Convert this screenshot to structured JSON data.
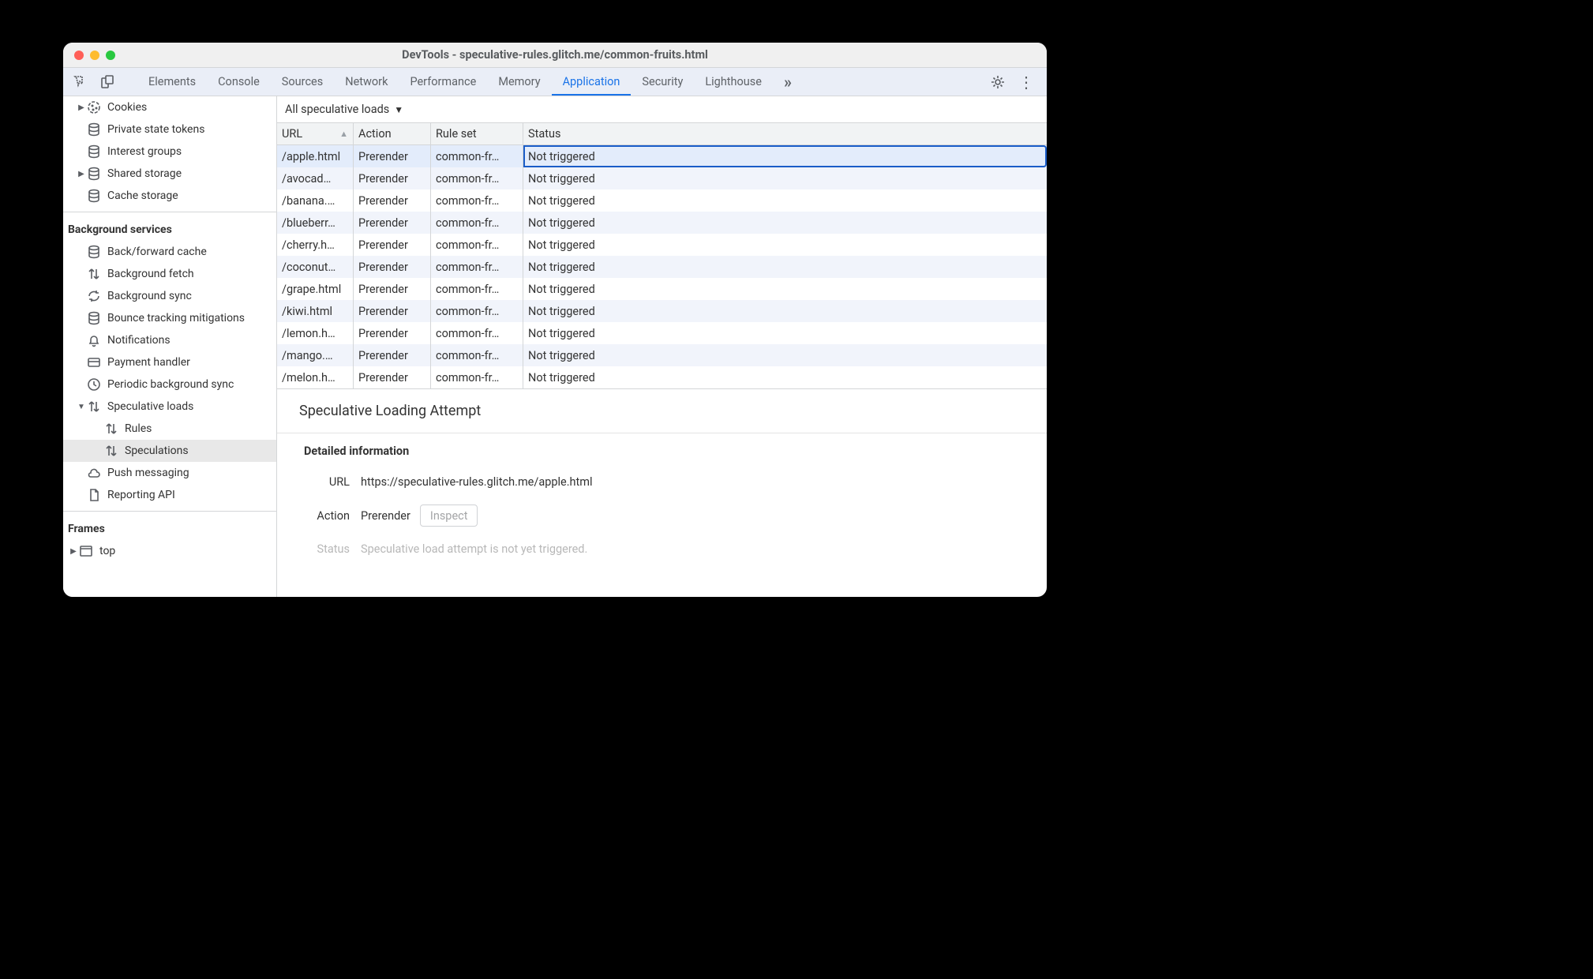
{
  "window_title": "DevTools - speculative-rules.glitch.me/common-fruits.html",
  "tabs": {
    "elements": "Elements",
    "console": "Console",
    "sources": "Sources",
    "network": "Network",
    "performance": "Performance",
    "memory": "Memory",
    "application": "Application",
    "security": "Security",
    "lighthouse": "Lighthouse"
  },
  "sidebar": {
    "storage_items": [
      {
        "label": "Cookies",
        "icon": "cookie",
        "arrow": "right"
      },
      {
        "label": "Private state tokens",
        "icon": "db",
        "arrow": ""
      },
      {
        "label": "Interest groups",
        "icon": "db",
        "arrow": ""
      },
      {
        "label": "Shared storage",
        "icon": "db",
        "arrow": "right"
      },
      {
        "label": "Cache storage",
        "icon": "db",
        "arrow": ""
      }
    ],
    "bg_header": "Background services",
    "bg_items": [
      {
        "label": "Back/forward cache",
        "icon": "db",
        "arrow": ""
      },
      {
        "label": "Background fetch",
        "icon": "updown",
        "arrow": ""
      },
      {
        "label": "Background sync",
        "icon": "sync",
        "arrow": ""
      },
      {
        "label": "Bounce tracking mitigations",
        "icon": "db",
        "arrow": ""
      },
      {
        "label": "Notifications",
        "icon": "bell",
        "arrow": ""
      },
      {
        "label": "Payment handler",
        "icon": "card",
        "arrow": ""
      },
      {
        "label": "Periodic background sync",
        "icon": "clock",
        "arrow": ""
      },
      {
        "label": "Speculative loads",
        "icon": "updown",
        "arrow": "down",
        "children": [
          {
            "label": "Rules",
            "icon": "updown"
          },
          {
            "label": "Speculations",
            "icon": "updown",
            "selected": true
          }
        ]
      },
      {
        "label": "Push messaging",
        "icon": "cloud",
        "arrow": ""
      },
      {
        "label": "Reporting API",
        "icon": "page",
        "arrow": ""
      }
    ],
    "frames_header": "Frames",
    "frames_item": {
      "label": "top",
      "icon": "frame",
      "arrow": "right"
    }
  },
  "filter_label": "All speculative loads",
  "table": {
    "headers": {
      "url": "URL",
      "action": "Action",
      "ruleset": "Rule set",
      "status": "Status"
    },
    "rows": [
      {
        "url": "/apple.html",
        "action": "Prerender",
        "ruleset": "common-fr…",
        "status": "Not triggered",
        "sel": true
      },
      {
        "url": "/avocad…",
        "action": "Prerender",
        "ruleset": "common-fr…",
        "status": "Not triggered"
      },
      {
        "url": "/banana.…",
        "action": "Prerender",
        "ruleset": "common-fr…",
        "status": "Not triggered"
      },
      {
        "url": "/blueberr…",
        "action": "Prerender",
        "ruleset": "common-fr…",
        "status": "Not triggered"
      },
      {
        "url": "/cherry.h…",
        "action": "Prerender",
        "ruleset": "common-fr…",
        "status": "Not triggered"
      },
      {
        "url": "/coconut…",
        "action": "Prerender",
        "ruleset": "common-fr…",
        "status": "Not triggered"
      },
      {
        "url": "/grape.html",
        "action": "Prerender",
        "ruleset": "common-fr…",
        "status": "Not triggered"
      },
      {
        "url": "/kiwi.html",
        "action": "Prerender",
        "ruleset": "common-fr…",
        "status": "Not triggered"
      },
      {
        "url": "/lemon.h…",
        "action": "Prerender",
        "ruleset": "common-fr…",
        "status": "Not triggered"
      },
      {
        "url": "/mango.…",
        "action": "Prerender",
        "ruleset": "common-fr…",
        "status": "Not triggered"
      },
      {
        "url": "/melon.h…",
        "action": "Prerender",
        "ruleset": "common-fr…",
        "status": "Not triggered"
      }
    ]
  },
  "detail": {
    "heading": "Speculative Loading Attempt",
    "subheading": "Detailed information",
    "url_label": "URL",
    "url_value": "https://speculative-rules.glitch.me/apple.html",
    "action_label": "Action",
    "action_value": "Prerender",
    "inspect": "Inspect",
    "status_label": "Status",
    "status_value": "Speculative load attempt is not yet triggered."
  }
}
